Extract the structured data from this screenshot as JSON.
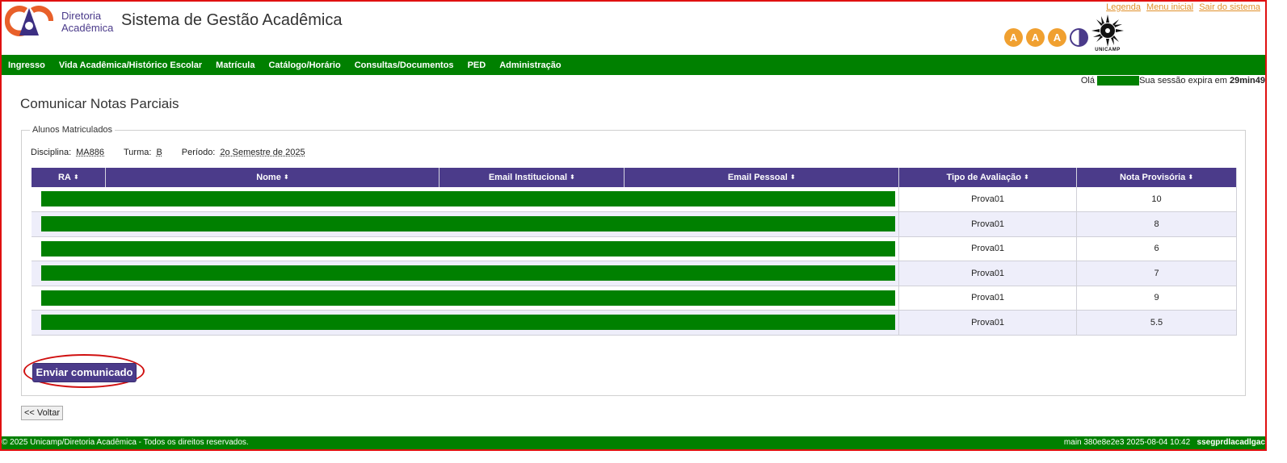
{
  "header": {
    "brand_line1": "Diretoria",
    "brand_line2": "Acadêmica",
    "system_title": "Sistema de Gestão Acadêmica",
    "links": [
      "Legenda",
      "Menu inicial",
      "Sair do sistema"
    ],
    "accessibility": [
      "A",
      "A",
      "A"
    ],
    "unicamp_label": "UNICAMP"
  },
  "nav": {
    "items": [
      "Ingresso",
      "Vida Acadêmica/Histórico Escolar",
      "Matrícula",
      "Catálogo/Horário",
      "Consultas/Documentos",
      "PED",
      "Administração"
    ]
  },
  "session": {
    "greeting": "Olá",
    "expires_text": "Sua sessão expira em",
    "time": "29min49"
  },
  "page": {
    "title": "Comunicar Notas Parciais",
    "legend": "Alunos Matriculados",
    "disciplina_label": "Disciplina:",
    "disciplina": "MA886",
    "turma_label": "Turma:",
    "turma": "B",
    "periodo_label": "Período:",
    "periodo": "2o Semestre de 2025"
  },
  "table": {
    "columns": [
      "RA",
      "Nome",
      "Email Institucional",
      "Email Pessoal",
      "Tipo de Avaliação",
      "Nota Provisória"
    ],
    "rows": [
      {
        "tipo": "Prova01",
        "nota": "10"
      },
      {
        "tipo": "Prova01",
        "nota": "8"
      },
      {
        "tipo": "Prova01",
        "nota": "6"
      },
      {
        "tipo": "Prova01",
        "nota": "7"
      },
      {
        "tipo": "Prova01",
        "nota": "9"
      },
      {
        "tipo": "Prova01",
        "nota": "5.5"
      }
    ]
  },
  "buttons": {
    "send": "Enviar comunicado",
    "back": "<< Voltar"
  },
  "footer": {
    "copyright": "© 2025 Unicamp/Diretoria Acadêmica - Todos os direitos reservados.",
    "build": "main 380e8e2e3 2025-08-04 10:42",
    "server": "ssegprdlacadlgac"
  },
  "colors": {
    "green": "#008000",
    "purple": "#4b3b8a",
    "orange": "#f0a030",
    "highlight_red": "#d01010"
  }
}
